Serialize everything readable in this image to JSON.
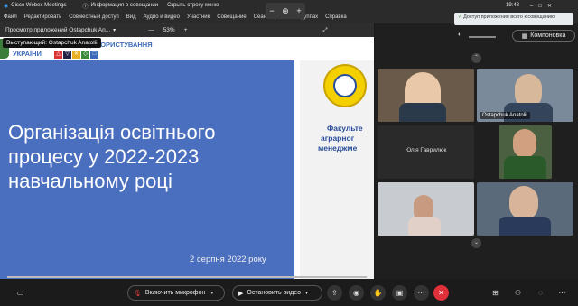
{
  "titlebar": {
    "app_name": "Cisco Webex Meetings",
    "meeting_info": "Информация о совещании",
    "hide_menu": "Скрыть строку меню",
    "time": "19:43"
  },
  "zoom": {
    "minus": "−",
    "plus": "+"
  },
  "menu": {
    "items": [
      "Файл",
      "Редактировать",
      "Совместный доступ",
      "Вид",
      "Аудио и видео",
      "Участник",
      "Совещание",
      "Сеансы работы в группах",
      "Справка"
    ]
  },
  "sharebar": {
    "label": "Просмотр приложений Ostapchuk An...",
    "zoom_value": "53%",
    "minus": "—",
    "plus": "+"
  },
  "presenter_tag": "Выступающий: Ostapchuk Anatolii",
  "slide": {
    "org_line1": "ВОРЕСУРСІВ І ПРИРОДОКОРИСТУВАННЯ",
    "org_line2": "УКРАЇНИ",
    "title": "Організація освітнього процесу у 2022-2023 навчальному році",
    "date": "2 серпня 2022 року",
    "right_line1": "Факульте",
    "right_line2": "аграрног",
    "right_line3": "менеджме"
  },
  "notification": "Доступ приложения всего к совещанию",
  "layout_button": "Компоновка",
  "participants": [
    {
      "name": ""
    },
    {
      "name": "Ostapchuk Anatolii"
    },
    {
      "name": "Юлія Гаврилюк"
    },
    {
      "name": ""
    },
    {
      "name": ""
    },
    {
      "name": ""
    }
  ],
  "controls": {
    "mic_label": "Включить микрофон",
    "video_label": "Остановить видео"
  },
  "colors": {
    "slide_blue": "#4a6fbf",
    "end_red": "#e0303a",
    "mute_red": "#e23b3b"
  }
}
